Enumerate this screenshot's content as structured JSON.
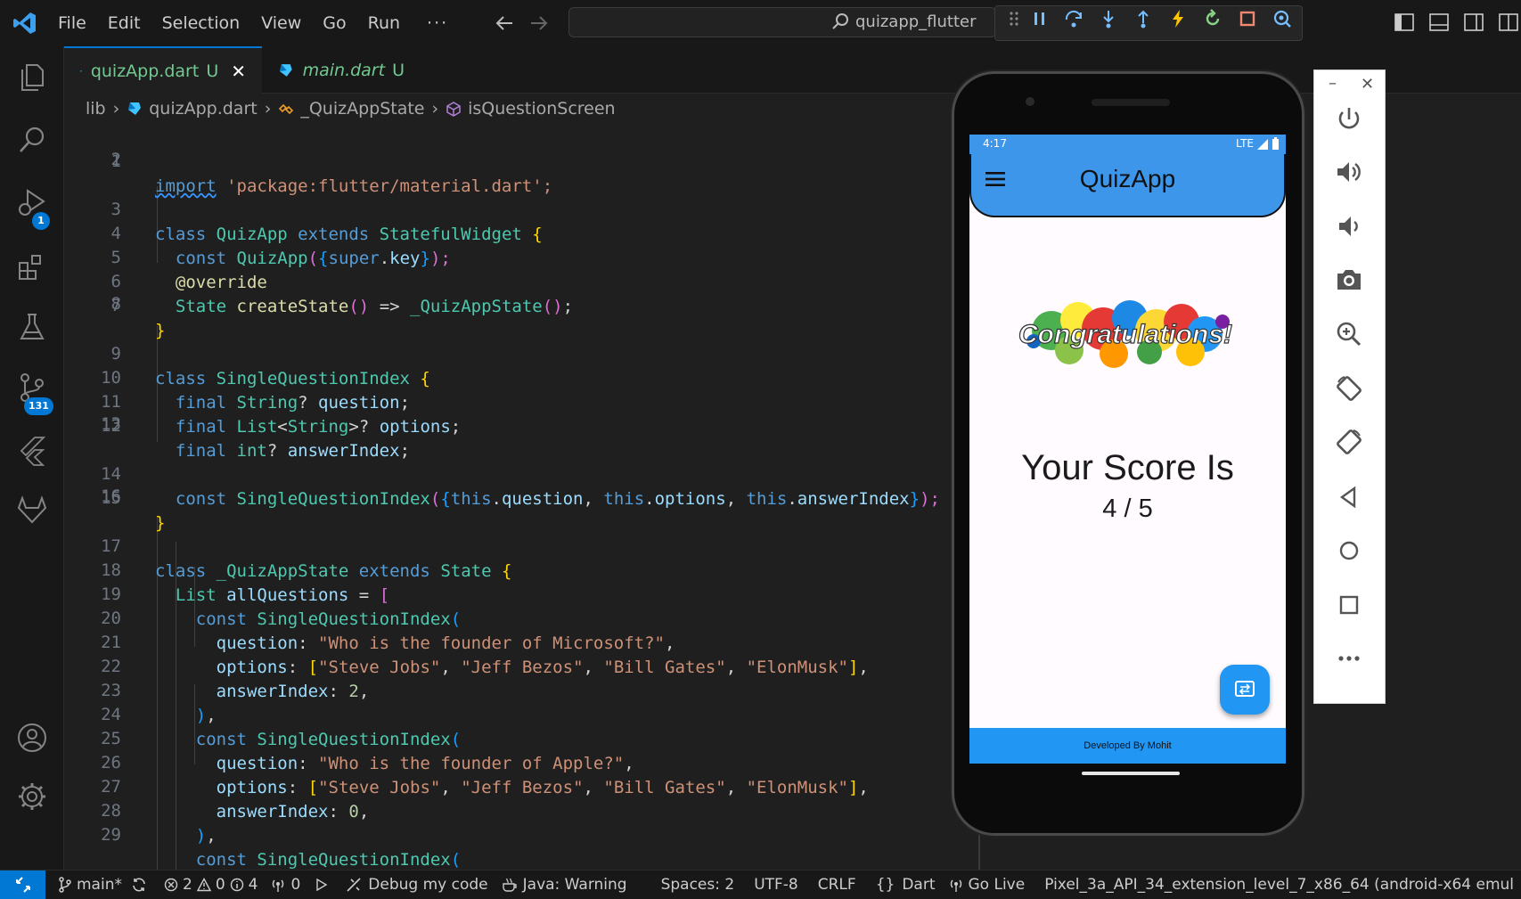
{
  "menu": [
    "File",
    "Edit",
    "Selection",
    "View",
    "Go",
    "Run"
  ],
  "menu_more": "···",
  "search": {
    "text": "quizapp_flutter"
  },
  "tabs": [
    {
      "label": "quizApp.dart",
      "flag": "U",
      "close": "✕"
    },
    {
      "label": "main.dart",
      "flag": "U"
    }
  ],
  "breadcrumb": [
    "lib",
    "quizApp.dart",
    "_QuizAppState",
    "isQuestionScreen"
  ],
  "activity": {
    "debug_badge": "1",
    "scm_badge": "131"
  },
  "line_numbers": [
    "1",
    "2",
    "3",
    "4",
    "5",
    "6",
    "7",
    "8",
    "9",
    "10",
    "11",
    "12",
    "13",
    "14",
    "15",
    "16",
    "17",
    "18",
    "19",
    "20",
    "21",
    "22",
    "23",
    "24",
    "25",
    "26",
    "27",
    "28",
    "29"
  ],
  "code": {
    "l1a": "import",
    "l1b": " 'package:flutter/material.dart';",
    "l3": [
      "class",
      " QuizApp",
      " extends",
      " StatefulWidget",
      " {"
    ],
    "l4": [
      "  const",
      " QuizApp",
      "(",
      "{",
      "super",
      ".",
      "key",
      "}",
      ");"
    ],
    "l5": "  @override",
    "l6": [
      "  State",
      " createState",
      "()",
      " => ",
      "_QuizAppState",
      "()",
      ";"
    ],
    "l7": "}",
    "l9": [
      "class",
      " SingleQuestionIndex",
      " {"
    ],
    "l10": [
      "  final",
      " String",
      "?",
      " question",
      ";"
    ],
    "l11": [
      "  final",
      " List",
      "<",
      "String",
      ">?",
      " options",
      ";"
    ],
    "l12": [
      "  final",
      " int",
      "?",
      " answerIndex",
      ";"
    ],
    "l14": [
      "  const",
      " SingleQuestionIndex",
      "(",
      "{",
      "this",
      ".",
      "question",
      ", ",
      "this",
      ".",
      "options",
      ", ",
      "this",
      ".",
      "answerIndex",
      "}",
      ");"
    ],
    "l15": "}",
    "l17": [
      "class",
      " _QuizAppState",
      " extends",
      " State",
      " {"
    ],
    "l18": [
      "  List",
      " allQuestions",
      " = ",
      "["
    ],
    "l19": [
      "    const",
      " SingleQuestionIndex",
      "("
    ],
    "l20": [
      "      question",
      ": ",
      "\"Who is the founder of Microsoft?\"",
      ","
    ],
    "l21": [
      "      options",
      ": ",
      "[",
      "\"Steve Jobs\"",
      ", ",
      "\"Jeff Bezos\"",
      ", ",
      "\"Bill Gates\"",
      ", ",
      "\"ElonMusk\"",
      "]",
      ","
    ],
    "l22": [
      "      answerIndex",
      ": ",
      "2",
      ","
    ],
    "l23": [
      "    )",
      ","
    ],
    "l24": [
      "    const",
      " SingleQuestionIndex",
      "("
    ],
    "l25": [
      "      question",
      ": ",
      "\"Who is the founder of Apple?\"",
      ","
    ],
    "l26": [
      "      options",
      ": ",
      "[",
      "\"Steve Jobs\"",
      ", ",
      "\"Jeff Bezos\"",
      ", ",
      "\"Bill Gates\"",
      ", ",
      "\"ElonMusk\"",
      "]",
      ","
    ],
    "l27": [
      "      answerIndex",
      ": ",
      "0",
      ","
    ],
    "l28": [
      "    )",
      ","
    ],
    "l29": [
      "    const",
      " SingleQuestionIndex",
      "("
    ]
  },
  "phone": {
    "time": "4:17",
    "network": "LTE",
    "app_title": "QuizApp",
    "congrats_text": "Congratulations!",
    "score_label": "Your Score Is",
    "score_value": "4 / 5",
    "footer": "Developed By Mohit"
  },
  "emulator": {
    "minimize": "–",
    "close": "✕"
  },
  "statusbar": {
    "branch": "main*",
    "errors": "2",
    "warnings": "0",
    "infos": "4",
    "ports": "0",
    "debug": "Debug my code",
    "java": "Java: Warning",
    "spaces": "Spaces: 2",
    "encoding": "UTF-8",
    "eol": "CRLF",
    "language": "Dart",
    "golive": "Go Live",
    "device": "Pixel_3a_API_34_extension_level_7_x86_64 (android-x64 emul"
  },
  "colors": {
    "accent": "#0078d4",
    "app_bar": "#3d96ea",
    "fab": "#2196f3"
  }
}
